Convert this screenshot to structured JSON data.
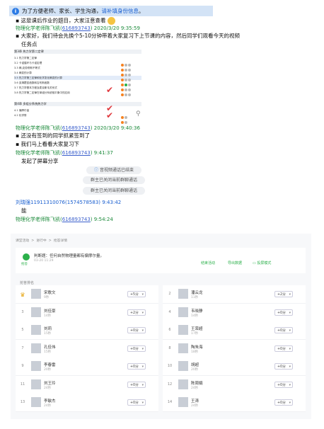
{
  "notice": {
    "text": "为了方便老师、家长、学生沟通，",
    "link": "请补填身份信息",
    "tail": "。"
  },
  "chat": [
    {
      "type": "text",
      "text": "这是课后作业的题目，大家注意查看",
      "bullet": "▪"
    },
    {
      "type": "sender",
      "name": "物理化学老师陈飞凯",
      "qq": "616893743",
      "time": "2020/3/20 9:35:59"
    },
    {
      "type": "text",
      "text": "大家好，我们待会先换个5-10分钟带着大家复习下上节课的内容，然后同学们观看今天的视频"
    },
    {
      "type": "text",
      "text": "任务点"
    },
    {
      "type": "sender",
      "name": "物理化学老师陈飞凯",
      "qq": "616893743",
      "time": "2020/3/20 9:40:36"
    },
    {
      "type": "text",
      "text": "还没有签到的同学抓紧签到了"
    },
    {
      "type": "text",
      "text": "我们马上看看大家复习下"
    },
    {
      "type": "sender",
      "name": "物理化学老师陈飞凯",
      "qq": "616893743",
      "time": "9:41:37"
    },
    {
      "type": "text",
      "text": "发起了屏幕分享"
    },
    {
      "type": "sender2",
      "name": "刘瑞强11911310076",
      "qq": "1574578583",
      "time": "9:43:42"
    },
    {
      "type": "text",
      "text": "能"
    },
    {
      "type": "sender",
      "name": "物理化学老师陈飞凯",
      "qq": "616893743",
      "time": "9:54:24"
    }
  ],
  "outline": {
    "chapter3": "第3章 热力学第二定律",
    "items3": [
      "3.1 热力学第二定律",
      "3.2 卡诺循环与卡诺定理",
      "3.3 熵,克劳修斯不等式",
      "3.4 熵变的计算",
      "3.5 热力学第三定律和化学变化熵变的计算",
      "3.6 亥姆霍兹函数和吉布斯函数",
      "3.7 热力学基本方程及麦克斯韦关系式",
      "3.8 热力学第二定律在单组分系统相平衡中的应用"
    ],
    "chapter4": "第4章 多组分系统热力学",
    "items4": [
      "4.1 偏摩尔量",
      "4.2 化学势"
    ]
  },
  "pills": [
    "音视频通话已结束",
    "群主已关闭当前群聊通话",
    "群主已关闭当前群聊通话"
  ],
  "panel": {
    "crumbs": [
      "课堂活动",
      "进行中",
      "抢答详情"
    ],
    "question": "判断题：任何自然物理量都有偏摩尔量。",
    "date": "03-20 11:29",
    "badge": "抢答",
    "actions": [
      "结束活动",
      "导出数据",
      "投屏模式"
    ],
    "rank_label": "抢答排名"
  },
  "ranking": [
    {
      "n": "",
      "name": "宋歌文",
      "t": "9秒",
      "s": "+5分"
    },
    {
      "n": "2",
      "name": "潘云龙",
      "t": "11秒",
      "s": "+2分"
    },
    {
      "n": "3",
      "name": "刘佳豪",
      "t": "14秒",
      "s": "+2分"
    },
    {
      "n": "4",
      "name": "韦晓静",
      "t": "14秒",
      "s": "+0分"
    },
    {
      "n": "5",
      "name": "刘莉",
      "t": "15秒",
      "s": "+0分"
    },
    {
      "n": "6",
      "name": "王荣超",
      "t": "17秒",
      "s": "+0分"
    },
    {
      "n": "7",
      "name": "孔佳伟",
      "t": "15秒",
      "s": "+0分"
    },
    {
      "n": "8",
      "name": "陶朱海",
      "t": "18秒",
      "s": "+0分"
    },
    {
      "n": "9",
      "name": "李春雷",
      "t": "20秒",
      "s": "+0分"
    },
    {
      "n": "10",
      "name": "胡超",
      "t": "20秒",
      "s": "+0分"
    },
    {
      "n": "11",
      "name": "刘王玲",
      "t": "24秒",
      "s": "+0分"
    },
    {
      "n": "12",
      "name": "陈周娟",
      "t": "24秒",
      "s": "+0分"
    },
    {
      "n": "13",
      "name": "李敏杰",
      "t": "24秒",
      "s": "+0分"
    },
    {
      "n": "14",
      "name": "王涛",
      "t": "24秒",
      "s": "+0分"
    }
  ]
}
